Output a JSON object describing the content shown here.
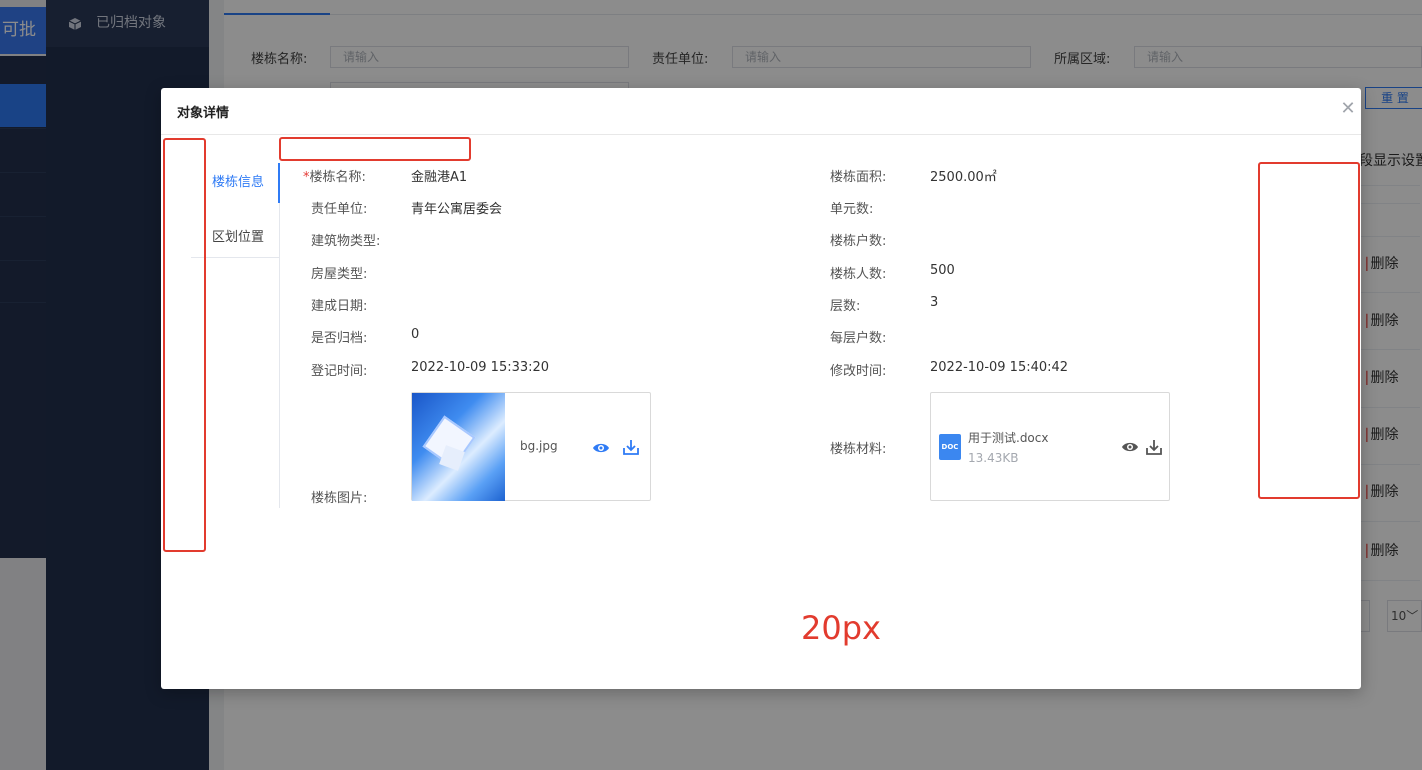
{
  "app_sidebar": {
    "approve_label": "审批",
    "approve_partial": "可批"
  },
  "submenu": {
    "archived_label": "已归档对象"
  },
  "filters": {
    "building_name_label": "楼栋名称:",
    "building_name_placeholder": "请输入",
    "unit_label": "责任单位:",
    "unit_placeholder": "请输入",
    "area_label": "所属区域:",
    "area_placeholder": "请输入",
    "reset_label": "重 置"
  },
  "table": {
    "column_setting_label": "段显示设置",
    "delete_label": "删除",
    "page_size": "10"
  },
  "dialog": {
    "title": "对象详情",
    "tabs": [
      {
        "label": "楼栋信息"
      },
      {
        "label": "区划位置"
      }
    ],
    "fields_left": [
      {
        "label": "楼栋名称:",
        "value": "金融港A1",
        "required": "*"
      },
      {
        "label": "责任单位:",
        "value": "青年公寓居委会"
      },
      {
        "label": "建筑物类型:",
        "value": ""
      },
      {
        "label": "房屋类型:",
        "value": ""
      },
      {
        "label": "建成日期:",
        "value": ""
      },
      {
        "label": "是否归档:",
        "value": "0"
      },
      {
        "label": "登记时间:",
        "value": "2022-10-09 15:33:20"
      }
    ],
    "fields_right": [
      {
        "label": "楼栋面积:",
        "value": "2500.00㎡"
      },
      {
        "label": "单元数:",
        "value": ""
      },
      {
        "label": "楼栋户数:",
        "value": ""
      },
      {
        "label": "楼栋人数:",
        "value": "500"
      },
      {
        "label": "层数:",
        "value": "3"
      },
      {
        "label": "每层户数:",
        "value": ""
      },
      {
        "label": "修改时间:",
        "value": "2022-10-09 15:40:42"
      }
    ],
    "picture_label": "楼栋图片:",
    "picture_file": "bg.jpg",
    "material_label": "楼栋材料:",
    "material_file": "用于测试.docx",
    "material_size": "13.43KB",
    "doc_badge": "DOC"
  },
  "annotation": {
    "gap_label": "20px",
    "color": "#e23b2e"
  },
  "colors": {
    "primary": "#2f7bf5",
    "sidebar_dark": "#22304d"
  }
}
